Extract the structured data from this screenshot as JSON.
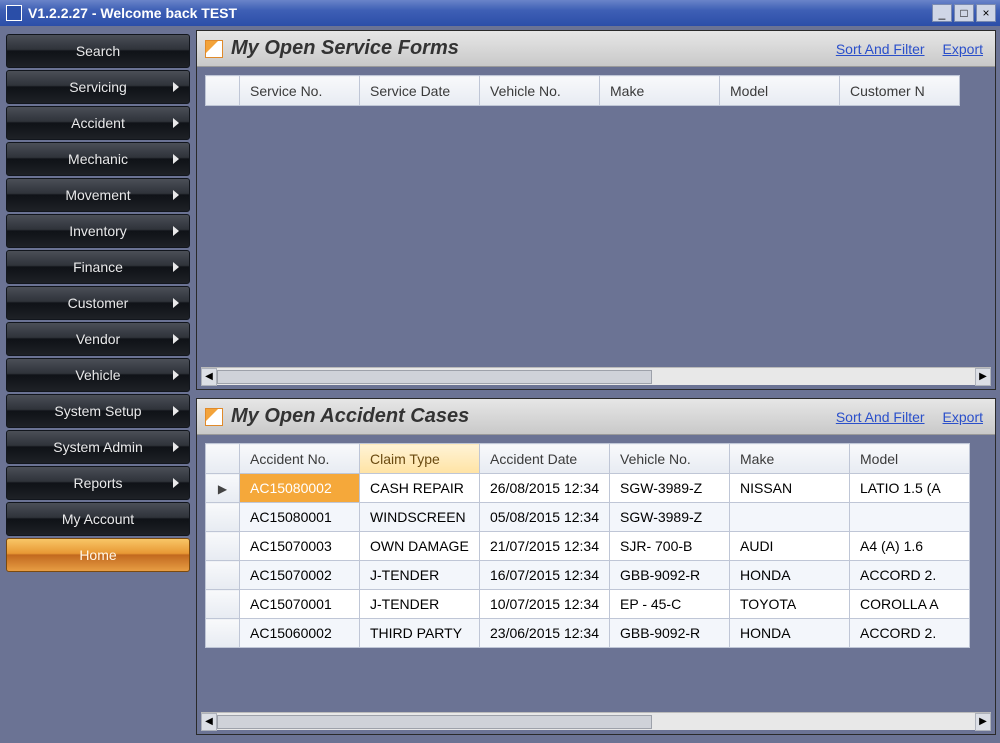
{
  "window": {
    "title": "V1.2.2.27 - Welcome back TEST"
  },
  "sidebar": {
    "items": [
      {
        "id": "search",
        "label": "Search",
        "hasSubmenu": false
      },
      {
        "id": "servicing",
        "label": "Servicing",
        "hasSubmenu": true
      },
      {
        "id": "accident",
        "label": "Accident",
        "hasSubmenu": true
      },
      {
        "id": "mechanic",
        "label": "Mechanic",
        "hasSubmenu": true
      },
      {
        "id": "movement",
        "label": "Movement",
        "hasSubmenu": true
      },
      {
        "id": "inventory",
        "label": "Inventory",
        "hasSubmenu": true
      },
      {
        "id": "finance",
        "label": "Finance",
        "hasSubmenu": true
      },
      {
        "id": "customer",
        "label": "Customer",
        "hasSubmenu": true
      },
      {
        "id": "vendor",
        "label": "Vendor",
        "hasSubmenu": true
      },
      {
        "id": "vehicle",
        "label": "Vehicle",
        "hasSubmenu": true
      },
      {
        "id": "system-setup",
        "label": "System Setup",
        "hasSubmenu": true
      },
      {
        "id": "system-admin",
        "label": "System Admin",
        "hasSubmenu": true
      },
      {
        "id": "reports",
        "label": "Reports",
        "hasSubmenu": true
      },
      {
        "id": "my-account",
        "label": "My Account",
        "hasSubmenu": false
      },
      {
        "id": "home",
        "label": "Home",
        "hasSubmenu": false,
        "active": true
      }
    ]
  },
  "panels": {
    "service": {
      "title": "My Open Service Forms",
      "sort_filter": "Sort And Filter",
      "export": "Export",
      "columns": [
        "Service No.",
        "Service Date",
        "Vehicle No.",
        "Make",
        "Model",
        "Customer N"
      ],
      "rows": []
    },
    "accident": {
      "title": "My Open Accident Cases",
      "sort_filter": "Sort And Filter",
      "export": "Export",
      "columns": [
        "Accident No.",
        "Claim Type",
        "Accident Date",
        "Vehicle No.",
        "Make",
        "Model"
      ],
      "sortedColumnIndex": 1,
      "selectedRowIndex": 0,
      "rows": [
        {
          "accident_no": "AC15080002",
          "claim_type": "CASH REPAIR",
          "accident_date": "26/08/2015 12:34",
          "vehicle_no": "SGW-3989-Z",
          "make": "NISSAN",
          "model": "LATIO 1.5 (A"
        },
        {
          "accident_no": "AC15080001",
          "claim_type": "WINDSCREEN",
          "accident_date": "05/08/2015 12:34",
          "vehicle_no": "SGW-3989-Z",
          "make": "",
          "model": ""
        },
        {
          "accident_no": "AC15070003",
          "claim_type": "OWN DAMAGE",
          "accident_date": "21/07/2015 12:34",
          "vehicle_no": "SJR- 700-B",
          "make": "AUDI",
          "model": "A4 (A) 1.6"
        },
        {
          "accident_no": "AC15070002",
          "claim_type": "J-TENDER",
          "accident_date": "16/07/2015 12:34",
          "vehicle_no": "GBB-9092-R",
          "make": "HONDA",
          "model": "ACCORD 2."
        },
        {
          "accident_no": "AC15070001",
          "claim_type": "J-TENDER",
          "accident_date": "10/07/2015 12:34",
          "vehicle_no": "EP - 45-C",
          "make": "TOYOTA",
          "model": "COROLLA A"
        },
        {
          "accident_no": "AC15060002",
          "claim_type": "THIRD PARTY",
          "accident_date": "23/06/2015 12:34",
          "vehicle_no": "GBB-9092-R",
          "make": "HONDA",
          "model": "ACCORD 2."
        }
      ]
    }
  }
}
